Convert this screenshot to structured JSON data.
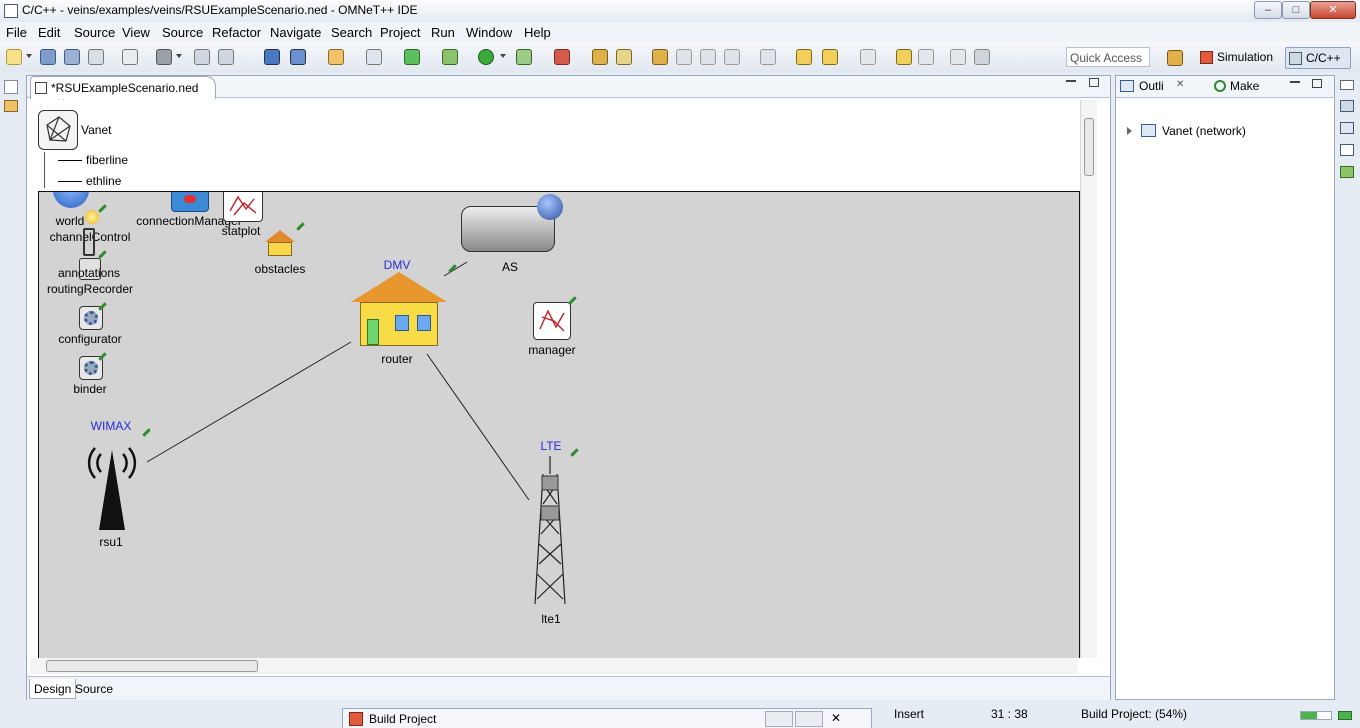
{
  "window": {
    "title": "C/C++ - veins/examples/veins/RSUExampleScenario.ned - OMNeT++ IDE",
    "min": "‒",
    "max": "□",
    "close": "✕"
  },
  "menu": [
    "File",
    "Edit",
    "Source",
    "View",
    "Source",
    "Refactor",
    "Navigate",
    "Search",
    "Project",
    "Run",
    "Window",
    "Help"
  ],
  "toolbar": {
    "quick_access_placeholder": "Quick Access",
    "perspective_simulation": "Simulation",
    "perspective_cpp": "C/C++"
  },
  "editor": {
    "tab_title": "*RSUExampleScenario.ned",
    "tab_close": "✕",
    "palette": {
      "network": "Vanet",
      "connections": [
        "fiberline",
        "ethline"
      ]
    },
    "bottom_tabs": [
      "Design",
      "Source"
    ],
    "nodes": {
      "world": "world",
      "connectionManager": "connectionManager",
      "statplot": "statplot",
      "channelControl": "channelControl",
      "obstacles": "obstacles",
      "annotations": "annotations",
      "routingRecorder": "routingRecorder",
      "configurator": "configurator",
      "binder": "binder",
      "as_label": "AS",
      "dmv_label": "DMV",
      "router": "router",
      "manager": "manager",
      "wimax_label": "WIMAX",
      "rsu1": "rsu1",
      "lte_label": "LTE",
      "lte1": "lte1"
    }
  },
  "outline": {
    "tab_outline": "Outli",
    "tab_make": "Make",
    "tree_item": "Vanet (network)"
  },
  "status": {
    "mode": "Insert",
    "position": "31 : 38",
    "progress_text": "Build Project: (54%)",
    "progress": 0.54,
    "build_window": "Build Project"
  },
  "colors": {
    "accent": "#2a2ae0",
    "canvas": "#d3d3d3",
    "pin": "#2e8b2e"
  }
}
